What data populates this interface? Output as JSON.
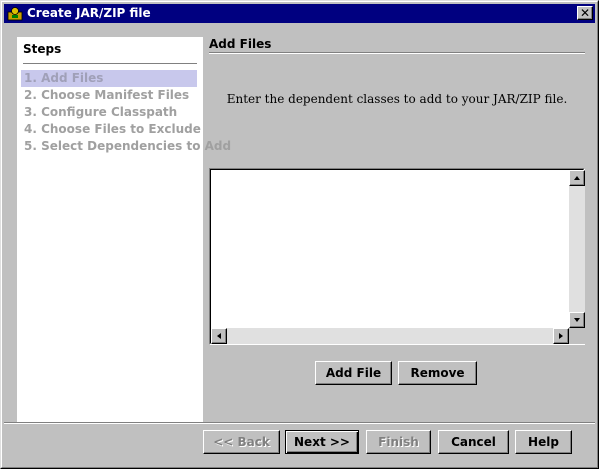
{
  "window": {
    "title": "Create JAR/ZIP file",
    "close_glyph": "✕",
    "titlebar_color": "#000080"
  },
  "steps": {
    "heading": "Steps",
    "items": [
      {
        "label": "1. Add Files",
        "active": true
      },
      {
        "label": "2. Choose Manifest Files",
        "active": false
      },
      {
        "label": "3. Configure Classpath",
        "active": false
      },
      {
        "label": "4. Choose Files to Exclude",
        "active": false
      },
      {
        "label": "5. Select Dependencies to Add",
        "active": false
      }
    ]
  },
  "content": {
    "section_title": "Add Files",
    "instructions": "Enter the dependent classes to add to your JAR/ZIP file.",
    "file_list": []
  },
  "actions": {
    "add_file": "Add File",
    "remove": "Remove"
  },
  "nav": {
    "back": "<< Back",
    "next": "Next >>",
    "finish": "Finish",
    "cancel": "Cancel",
    "help": "Help"
  },
  "icons": {
    "app": "jdeveloper-app-icon",
    "close": "close-icon",
    "scroll_up": "arrow-up-icon",
    "scroll_down": "arrow-down-icon",
    "scroll_left": "arrow-left-icon",
    "scroll_right": "arrow-right-icon"
  }
}
